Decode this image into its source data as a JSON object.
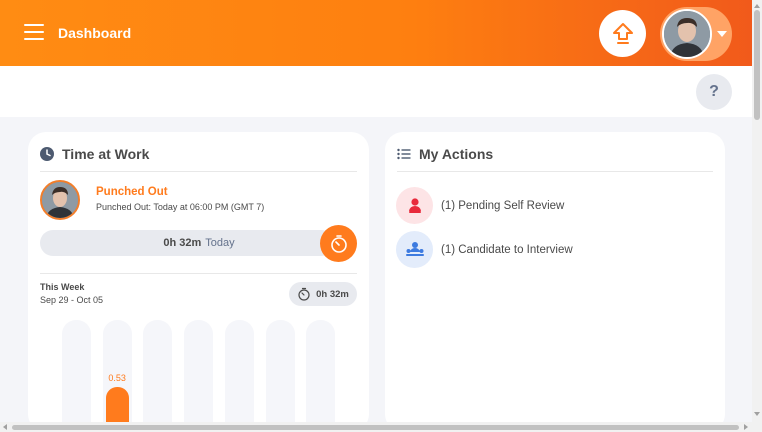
{
  "topbar": {
    "title": "Dashboard",
    "menu_icon": "hamburger-icon",
    "upgrade_icon": "upgrade-arrow-icon",
    "profile_caret_icon": "caret-down-icon"
  },
  "subbar": {
    "help_label": "?"
  },
  "time_at_work": {
    "title": "Time at Work",
    "icon": "clock-icon",
    "status": "Punched Out",
    "detail": "Punched Out: Today at 06:00 PM (GMT 7)",
    "today_duration": "0h 32m",
    "today_label": "Today",
    "timer_icon": "stopwatch-icon",
    "week_label": "This Week",
    "week_range": "Sep 29 - Oct 05",
    "week_total": "0h 32m",
    "bars": [
      {
        "value": null
      },
      {
        "value": 0.53,
        "label": "0.53"
      },
      {
        "value": null
      },
      {
        "value": null
      },
      {
        "value": null
      },
      {
        "value": null
      },
      {
        "value": null
      }
    ],
    "bar_max": 1.2
  },
  "my_actions": {
    "title": "My Actions",
    "icon": "list-icon",
    "items": [
      {
        "label": "(1) Pending Self Review",
        "icon": "self-review-icon",
        "color": "#e8293b",
        "bg": "#fde4e6"
      },
      {
        "label": "(1) Candidate to Interview",
        "icon": "interview-icon",
        "color": "#3d7be0",
        "bg": "#e3ecfb"
      }
    ]
  },
  "colors": {
    "accent": "#ff7b1d",
    "topbar_start": "#ff8c13",
    "topbar_end": "#f15a1b"
  }
}
